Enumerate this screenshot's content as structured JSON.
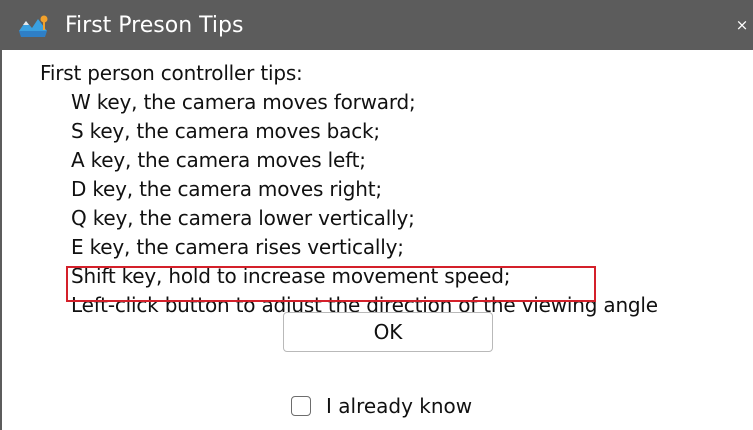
{
  "window": {
    "title": "First Preson Tips",
    "close_glyph": "×",
    "icon": "app-icon",
    "titlebar_color": "#5c5c5c"
  },
  "content": {
    "heading": "First person controller tips:",
    "tips": [
      "W key, the camera moves forward;",
      "S key, the camera moves back;",
      "A key, the camera moves left;",
      "D key, the camera moves right;",
      "Q key, the camera lower vertically;",
      "E key, the camera rises vertically;",
      "Shift key, hold to increase movement speed;",
      "Left-click button to adjust the direction of the viewing angle"
    ],
    "highlighted_tip_index": 6,
    "highlight_color": "#d4202a"
  },
  "actions": {
    "ok_label": "OK",
    "checkbox_label": "I already know",
    "checkbox_checked": false
  }
}
